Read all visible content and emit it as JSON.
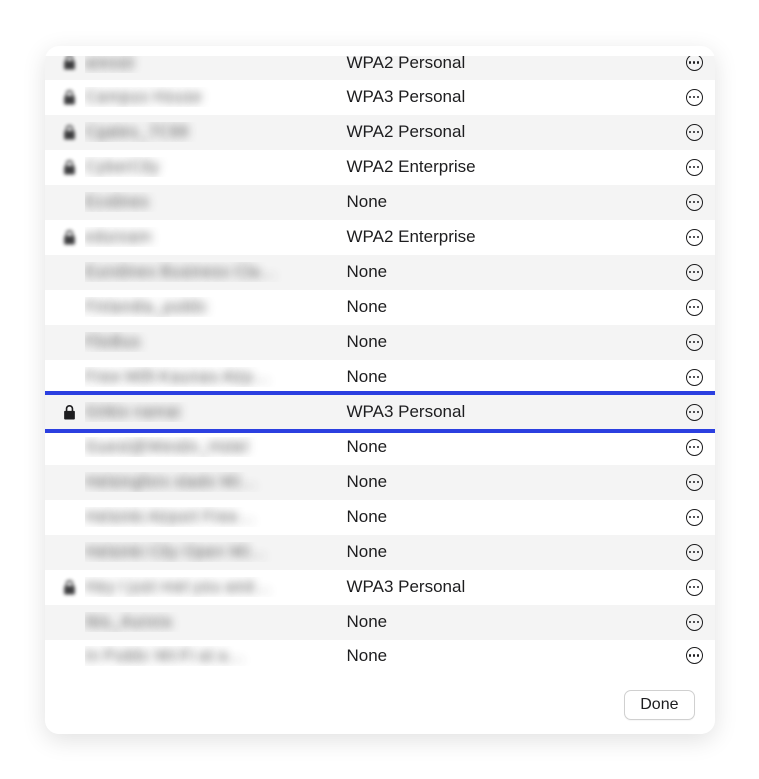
{
  "footer": {
    "done_label": "Done"
  },
  "networks": [
    {
      "name": "aressii",
      "security": "WPA2 Personal",
      "locked": true,
      "blurred": true,
      "highlighted": false,
      "partial": "top"
    },
    {
      "name": "Campus House",
      "security": "WPA3 Personal",
      "locked": true,
      "blurred": true,
      "highlighted": false,
      "partial": ""
    },
    {
      "name": "Cgates_7C98",
      "security": "WPA2 Personal",
      "locked": true,
      "blurred": true,
      "highlighted": false,
      "partial": ""
    },
    {
      "name": "CyberCity",
      "security": "WPA2 Enterprise",
      "locked": true,
      "blurred": true,
      "highlighted": false,
      "partial": ""
    },
    {
      "name": "Ecolines",
      "security": "None",
      "locked": false,
      "blurred": true,
      "highlighted": false,
      "partial": ""
    },
    {
      "name": "eduroam",
      "security": "WPA2 Enterprise",
      "locked": true,
      "blurred": true,
      "highlighted": false,
      "partial": ""
    },
    {
      "name": "Eurolines Business Cla…",
      "security": "None",
      "locked": false,
      "blurred": true,
      "highlighted": false,
      "partial": ""
    },
    {
      "name": "Finlandia_public",
      "security": "None",
      "locked": false,
      "blurred": true,
      "highlighted": false,
      "partial": ""
    },
    {
      "name": "FlixBus",
      "security": "None",
      "locked": false,
      "blurred": true,
      "highlighted": false,
      "partial": ""
    },
    {
      "name": "Free-Wifi-Kaunas-Airp…",
      "security": "None",
      "locked": false,
      "blurred": true,
      "highlighted": false,
      "partial": ""
    },
    {
      "name": "Grikio namai",
      "security": "WPA3 Personal",
      "locked": true,
      "blurred": true,
      "highlighted": true,
      "partial": ""
    },
    {
      "name": "Guest@Westin_Hotel",
      "security": "None",
      "locked": false,
      "blurred": true,
      "highlighted": false,
      "partial": ""
    },
    {
      "name": "Helsingfors stads Wi…",
      "security": "None",
      "locked": false,
      "blurred": true,
      "highlighted": false,
      "partial": ""
    },
    {
      "name": "Helsinki Airport Free…",
      "security": "None",
      "locked": false,
      "blurred": true,
      "highlighted": false,
      "partial": ""
    },
    {
      "name": "Helsinki City Open Wi…",
      "security": "None",
      "locked": false,
      "blurred": true,
      "highlighted": false,
      "partial": ""
    },
    {
      "name": "Hey I just met you and…",
      "security": "WPA3 Personal",
      "locked": true,
      "blurred": true,
      "highlighted": false,
      "partial": ""
    },
    {
      "name": "Ibis_Aurora",
      "security": "None",
      "locked": false,
      "blurred": true,
      "highlighted": false,
      "partial": ""
    },
    {
      "name": "In Public Wi-Fi at a…",
      "security": "None",
      "locked": false,
      "blurred": true,
      "highlighted": false,
      "partial": "bottom"
    }
  ]
}
